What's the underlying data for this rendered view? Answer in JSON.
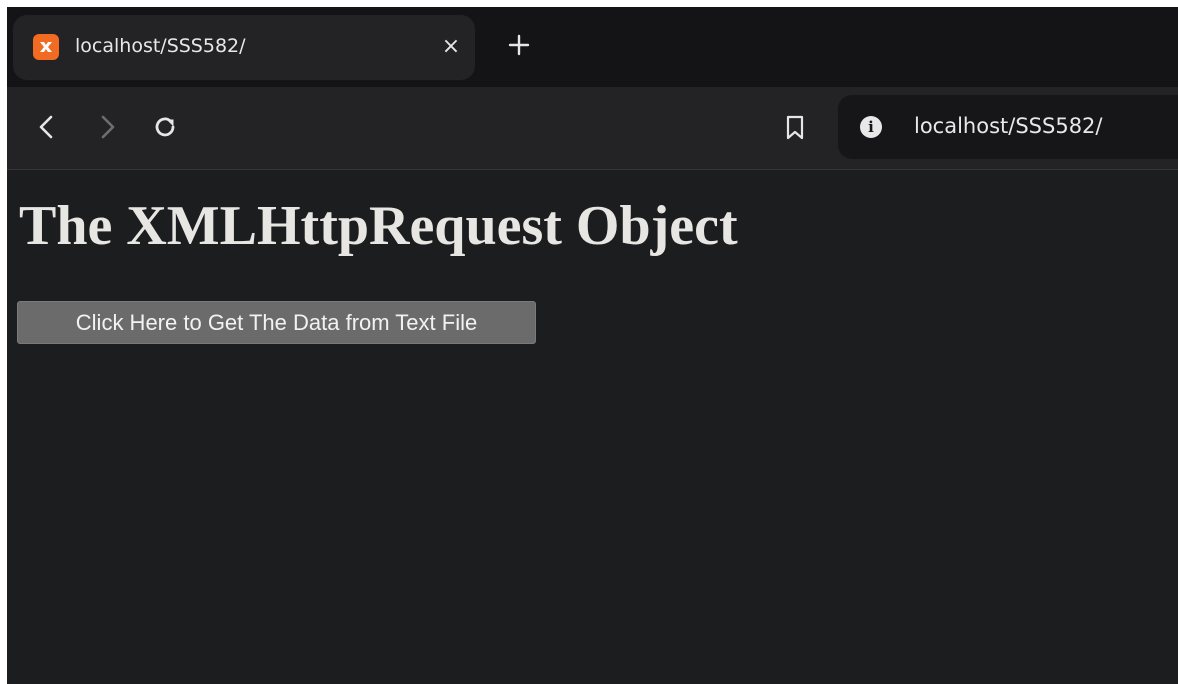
{
  "browser": {
    "tab": {
      "title": "localhost/SSS582/",
      "close_glyph": "×",
      "favicon": "xampp-icon"
    },
    "new_tab_icon": "plus-icon",
    "toolbar": {
      "back_icon": "chevron-left-icon",
      "forward_icon": "chevron-right-icon",
      "reload_icon": "reload-icon",
      "bookmark_icon": "bookmark-icon"
    },
    "address_bar": {
      "info_icon": "info-icon",
      "info_glyph": "i",
      "url": "localhost/SSS582/"
    }
  },
  "page": {
    "heading": "The XMLHttpRequest Object",
    "button_label": "Click Here to Get The Data from Text File"
  },
  "colors": {
    "page_background": "#1c1d1f",
    "tabstrip_background": "#141416",
    "toolbar_background": "#232326",
    "favicon_accent": "#f26b22",
    "button_background": "#6b6b6b",
    "heading_text": "#e8e6e3"
  }
}
